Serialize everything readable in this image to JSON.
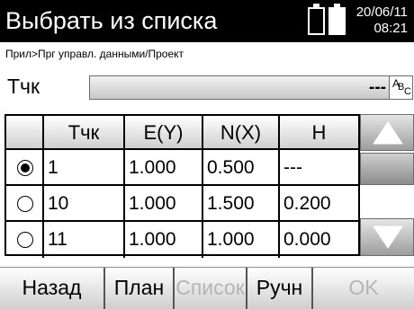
{
  "header": {
    "title": "Выбрать из списка",
    "date": "20/06/11",
    "time": "08:21"
  },
  "breadcrumb": "Прил>Прг управл. данными/Проект",
  "search": {
    "label": "Тчк",
    "value": "---",
    "abc_button": [
      "A",
      "B",
      "C"
    ]
  },
  "table": {
    "headers": [
      "",
      "Тчк",
      "E(Y)",
      "N(X)",
      "H"
    ],
    "rows": [
      {
        "selected": true,
        "point": "1",
        "e": "1.000",
        "n": "0.500",
        "h": "---"
      },
      {
        "selected": false,
        "point": "10",
        "e": "1.000",
        "n": "1.500",
        "h": "0.200"
      },
      {
        "selected": false,
        "point": "11",
        "e": "1.000",
        "n": "1.000",
        "h": "0.000"
      }
    ]
  },
  "softkeys": {
    "back": "Назад",
    "plan": "План",
    "list": "Список",
    "manual": "Ручн",
    "ok": "OK"
  },
  "colors": {
    "title_bg": "#000000",
    "disabled_text": "#b5b5b5"
  }
}
